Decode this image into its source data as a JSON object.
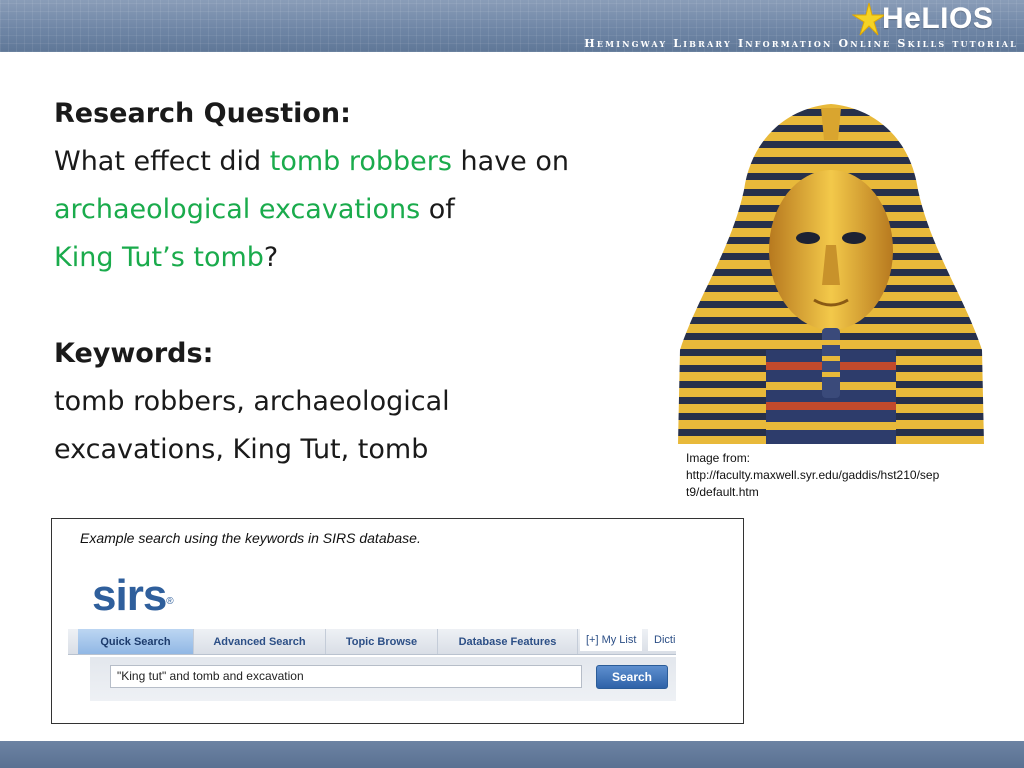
{
  "header": {
    "logo_text": "HeLIOS",
    "tagline": "Hemingway Library Information Online Skills tutorial"
  },
  "slide": {
    "research_heading": "Research Question:",
    "question_part1": "What effect did ",
    "question_hl1": "tomb robbers",
    "question_part2": " have on ",
    "question_hl2": "archaeological excavations",
    "question_part3": " of ",
    "question_hl3": "King Tut’s tomb",
    "question_end": "?",
    "keywords_heading": "Keywords:",
    "keywords_text": "tomb robbers, archaeological excavations, King Tut, tomb"
  },
  "image_credit": {
    "line1": "Image from:",
    "line2": "http://faculty.maxwell.syr.edu/gaddis/hst210/sep",
    "line3": "t9/default.htm"
  },
  "example": {
    "caption": "Example search using the keywords in SIRS database.",
    "logo": "sirs",
    "logo_mark": "®",
    "tabs": [
      "Quick Search",
      "Advanced Search",
      "Topic Browse",
      "Database Features"
    ],
    "extra_links": [
      "[+] My List",
      "Dicti"
    ],
    "search_value": "\"King tut\" and tomb and excavation",
    "search_button": "Search"
  },
  "colors": {
    "highlight": "#1aab4c",
    "header": "#6f86a6",
    "sirs_blue": "#2f5f9c"
  }
}
